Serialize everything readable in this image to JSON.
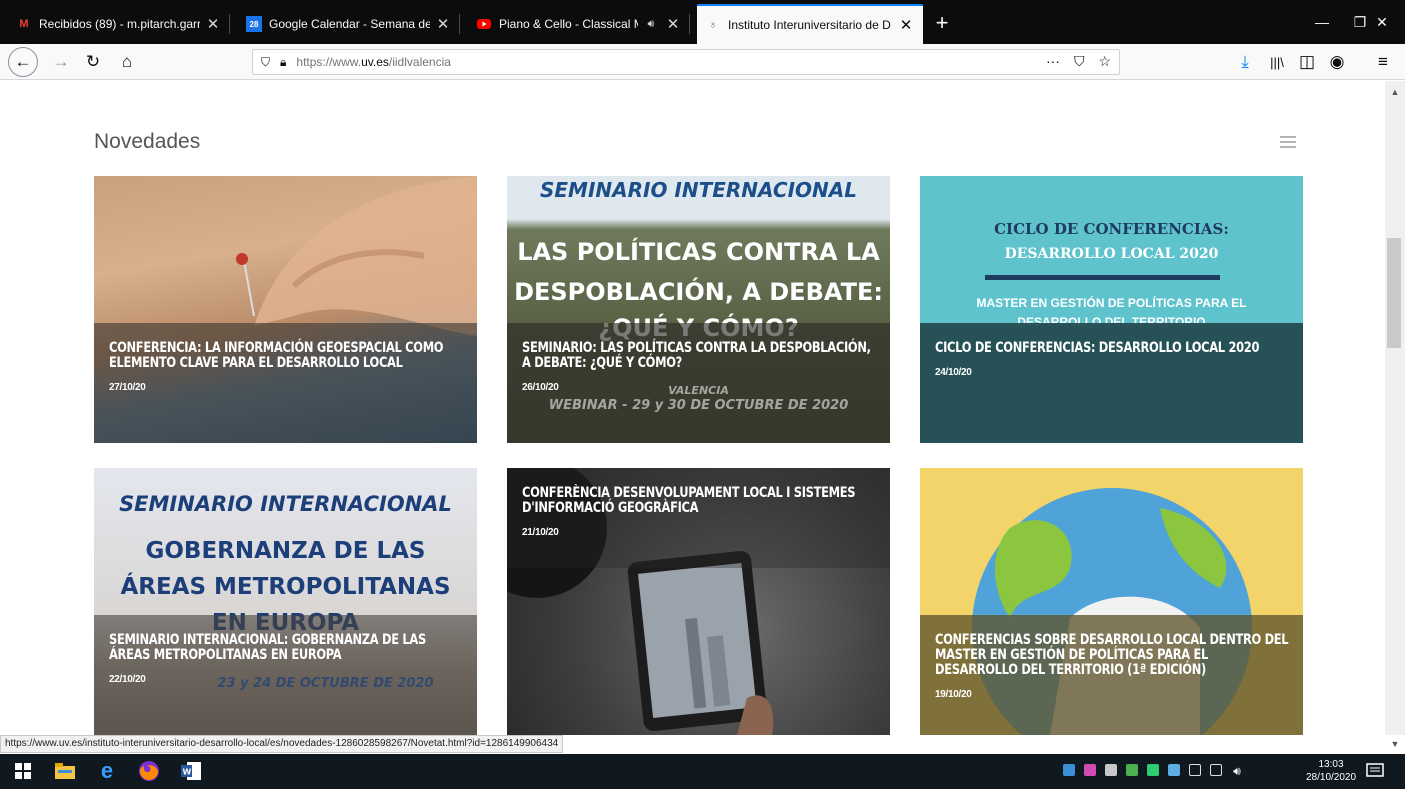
{
  "browser": {
    "tabs": [
      {
        "title": "Recibidos (89) - m.pitarch.garr",
        "favicon": "gmail-icon",
        "favicon_color": "#ea4335",
        "active": false
      },
      {
        "title": "Google Calendar - Semana del",
        "favicon": "calendar-icon",
        "favicon_color": "#1a73e8",
        "favicon_text": "28",
        "active": false
      },
      {
        "title": "Piano & Cello - Classical M",
        "favicon": "youtube-icon",
        "favicon_color": "#ff0000",
        "active": false,
        "audio": true
      },
      {
        "title": "Instituto Interuniversitario de D",
        "favicon": "institute-icon",
        "favicon_color": "#6b6b6b",
        "active": true
      }
    ],
    "url": {
      "prefix": "https://www.",
      "domain": "uv.es",
      "path": "/iidlvalencia"
    },
    "status_url": "https://www.uv.es/instituto-interuniversitario-desarrollo-local/es/novedades-1286028598267/Novetat.html?id=1286149906434"
  },
  "page": {
    "section_title": "Novedades",
    "cards": [
      {
        "title": "Conferencia: La información geoespacial como elemento clave para el desarrollo local",
        "date": "27/10/20"
      },
      {
        "title": "Seminario: Las políticas contra la despoblación, a debate: ¿qué y cómo?",
        "date": "26/10/20",
        "poster": {
          "line1": "SEMINARIO INTERNACIONAL",
          "line2": "LAS POLÍTICAS CONTRA LA",
          "line3": "DESPOBLACIÓN, A DEBATE:",
          "line4": "¿QUÉ Y CÓMO?",
          "line5": "VALENCIA",
          "line6": "WEBINAR - 29 y 30 DE OCTUBRE DE 2020"
        }
      },
      {
        "title": "Ciclo de conferencias: Desarrollo local 2020",
        "date": "24/10/20",
        "poster": {
          "line1": "CICLO DE CONFERENCIAS:",
          "line2": "DESARROLLO LOCAL 2020",
          "line3": "MASTER EN GESTIÓN DE POLÍTICAS PARA EL",
          "line4": "DESARROLLO DEL TERRITORIO"
        }
      },
      {
        "title": "Seminario internacional: Gobernanza de las áreas metropolitanas en Europa",
        "date": "22/10/20",
        "poster": {
          "line1": "SEMINARIO INTERNACIONAL",
          "line2": "GOBERNANZA DE LAS",
          "line3": "ÁREAS METROPOLITANAS",
          "line4": "EN EUROPA",
          "line5": "23 y 24 DE OCTUBRE DE 2020"
        }
      },
      {
        "title": "Conferència desenvolupament local i sistemes d'informació geogràfica",
        "date": "21/10/20"
      },
      {
        "title": "Conferencias sobre desarrollo local dentro del master en gestión de políticas para el desarrollo del territorio (1ª edición)",
        "date": "19/10/20"
      }
    ]
  },
  "taskbar": {
    "time": "13:03",
    "date": "28/10/2020"
  },
  "colors": {
    "accent": "#0a84ff",
    "download": "#0a84ff"
  }
}
